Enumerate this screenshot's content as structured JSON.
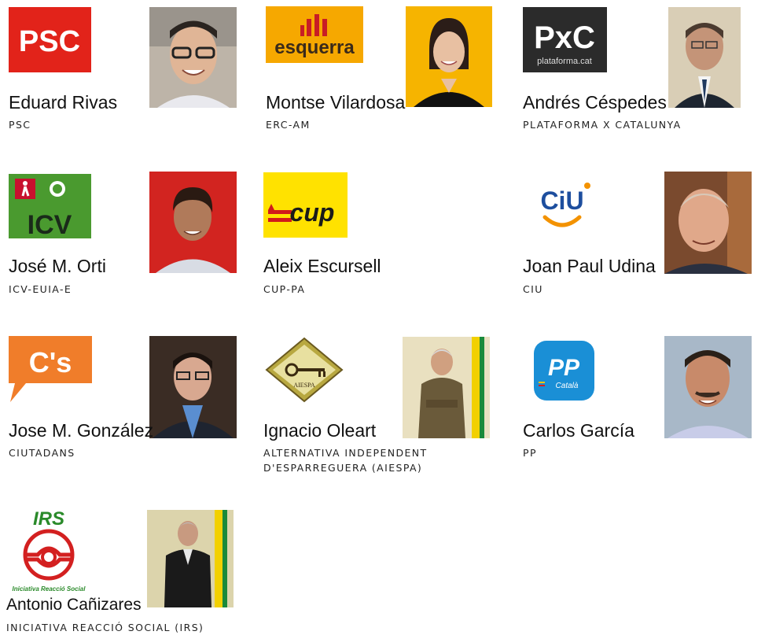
{
  "candidates": [
    {
      "name": "Eduard Rivas",
      "party": "PSC",
      "logo_text": "PSC"
    },
    {
      "name": "Montse Vilardosa",
      "party": "ERC-AM",
      "logo_text": "esquerra"
    },
    {
      "name": "Andrés Céspedes",
      "party": "PLATAFORMA X CATALUNYA",
      "logo_text": "PxC",
      "logo_subtext": "plataforma.cat"
    },
    {
      "name": "José M. Orti",
      "party": "ICV-EUIA-E",
      "logo_text": "ICV"
    },
    {
      "name": "Aleix Escursell",
      "party": "CUP-PA",
      "logo_text": "cup"
    },
    {
      "name": "Joan Paul Udina",
      "party": "CIU",
      "logo_text": "CiU"
    },
    {
      "name": "Jose M. González",
      "party": "CIUTADANS",
      "logo_text": "C's"
    },
    {
      "name": "Ignacio Oleart",
      "party": "ALTERNATIVA INDEPENDENT D'ESPARREGUERA (AIESPA)",
      "logo_text": "AIESPA"
    },
    {
      "name": "Carlos García",
      "party": "PP",
      "logo_text": "PP",
      "logo_subtext": "Català"
    },
    {
      "name": "Antonio Cañizares",
      "party": "INICIATIVA REACCIÓ SOCIAL (IRS)",
      "logo_text": "IRS",
      "logo_subtext": "Iniciativa Reacció Social"
    }
  ],
  "colors": {
    "psc": "#e2231a",
    "esquerra_bg": "#f6a800",
    "pxc_bg": "#2b2b2b",
    "icv_green": "#4a9a2f",
    "cup_yellow": "#ffe200",
    "ciu_blue": "#1d4e9e",
    "cs_orange": "#f07d2a",
    "pp_blue": "#1a8fd6",
    "irs_red": "#d32020",
    "irs_green": "#2a8a2a"
  },
  "icons": [
    "person-photo",
    "party-logo"
  ]
}
